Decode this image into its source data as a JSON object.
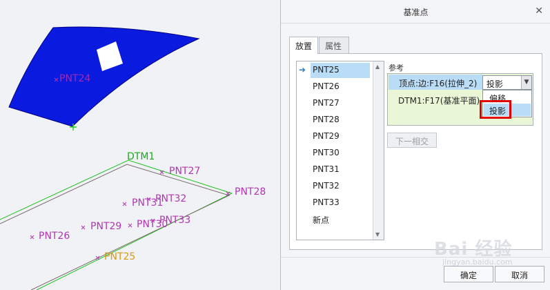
{
  "viewport": {
    "points": {
      "pnt24": "PNT24",
      "pnt27": "PNT27",
      "pnt28": "PNT28",
      "pnt31": "PNT31",
      "pnt32": "PNT32",
      "pnt29": "PNT29",
      "pnt30": "PNT30",
      "pnt33": "PNT33",
      "pnt26": "PNT26",
      "pnt25": "PNT25"
    },
    "datum": "DTM1"
  },
  "dialog": {
    "title": "基准点",
    "close_icon": "close-icon",
    "tabs": {
      "placement": "放置",
      "properties": "属性"
    },
    "point_list": [
      "PNT25",
      "PNT26",
      "PNT27",
      "PNT28",
      "PNT29",
      "PNT30",
      "PNT31",
      "PNT32",
      "PNT33",
      "新点"
    ],
    "selected_point": "PNT25",
    "references": {
      "label": "参考",
      "rows": [
        "顶点:边:F16(拉伸_2)",
        "DTM1:F17(基准平面)"
      ],
      "constraint_value": "投影",
      "dropdown_options": [
        "偏移",
        "投影"
      ]
    },
    "next_intersection": "下一相交",
    "ok": "确定",
    "cancel": "取消"
  },
  "watermark": {
    "text": "Bai 经验",
    "sub": "jingyan.baidu.com"
  },
  "colors": {
    "surface": "#0a1adf",
    "point": "#b236b2",
    "highlight": "#e00000",
    "selection": "#b9dcf7"
  }
}
